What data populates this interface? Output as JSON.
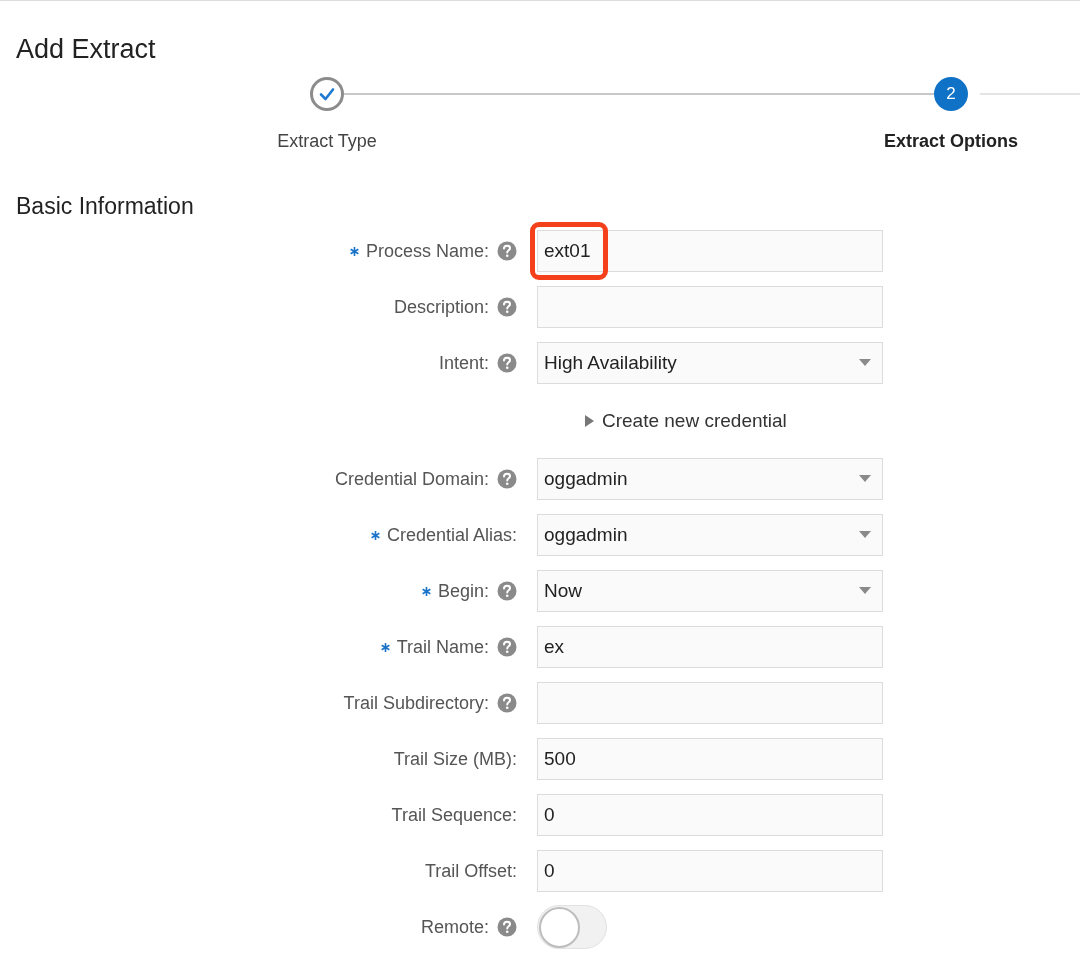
{
  "page_title": "Add Extract",
  "steps": [
    {
      "label": "Extract Type",
      "completed": true,
      "selected": false
    },
    {
      "label": "Extract Options",
      "completed": false,
      "selected": true,
      "number": "2"
    }
  ],
  "section_title": "Basic Information",
  "fields": [
    {
      "kind": "text",
      "label": "Process Name:",
      "required": true,
      "help": true,
      "value": "ext01",
      "highlighted": true
    },
    {
      "kind": "text",
      "label": "Description:",
      "required": false,
      "help": true
    },
    {
      "kind": "select",
      "label": "Intent:",
      "required": false,
      "help": true,
      "value": "High Availability"
    },
    {
      "kind": "expander",
      "label": "Create new credential",
      "expanded": false
    },
    {
      "kind": "select",
      "label": "Credential Domain:",
      "required": false,
      "help": true,
      "value": "oggadmin"
    },
    {
      "kind": "select",
      "label": "Credential Alias:",
      "required": true,
      "help": false,
      "value": "oggadmin"
    },
    {
      "kind": "select",
      "label": "Begin:",
      "required": true,
      "help": true,
      "value": "Now"
    },
    {
      "kind": "text",
      "label": "Trail Name:",
      "required": true,
      "help": true,
      "value": "ex"
    },
    {
      "kind": "text",
      "label": "Trail Subdirectory:",
      "required": false,
      "help": true
    },
    {
      "kind": "text",
      "label": "Trail Size (MB):",
      "required": false,
      "help": false,
      "value": "500"
    },
    {
      "kind": "text",
      "label": "Trail Sequence:",
      "required": false,
      "help": false,
      "value": "0"
    },
    {
      "kind": "text",
      "label": "Trail Offset:",
      "required": false,
      "help": false,
      "value": "0"
    },
    {
      "kind": "toggle",
      "label": "Remote:",
      "required": false,
      "help": true,
      "on": false
    }
  ]
}
